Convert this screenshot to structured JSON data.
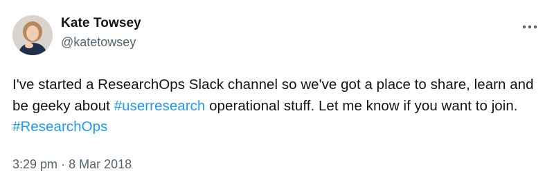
{
  "author": {
    "display_name": "Kate Towsey",
    "handle": "@katetowsey",
    "avatar_icon": "profile-photo-avatar"
  },
  "menu": {
    "more_icon": "more-options-icon"
  },
  "tweet": {
    "segments": [
      {
        "type": "text",
        "text": "I've started a ResearchOps Slack channel so we've got a place to share, learn and be geeky about "
      },
      {
        "type": "hashtag",
        "text": "#userresearch"
      },
      {
        "type": "text",
        "text": " operational stuff. Let me know if you want to join. "
      },
      {
        "type": "hashtag",
        "text": "#ResearchOps"
      }
    ]
  },
  "meta": {
    "time": "3:29 pm",
    "separator": "·",
    "date": "8 Mar 2018"
  },
  "colors": {
    "text": "#0f1419",
    "secondary": "#536471",
    "link": "#1d9bf0"
  }
}
